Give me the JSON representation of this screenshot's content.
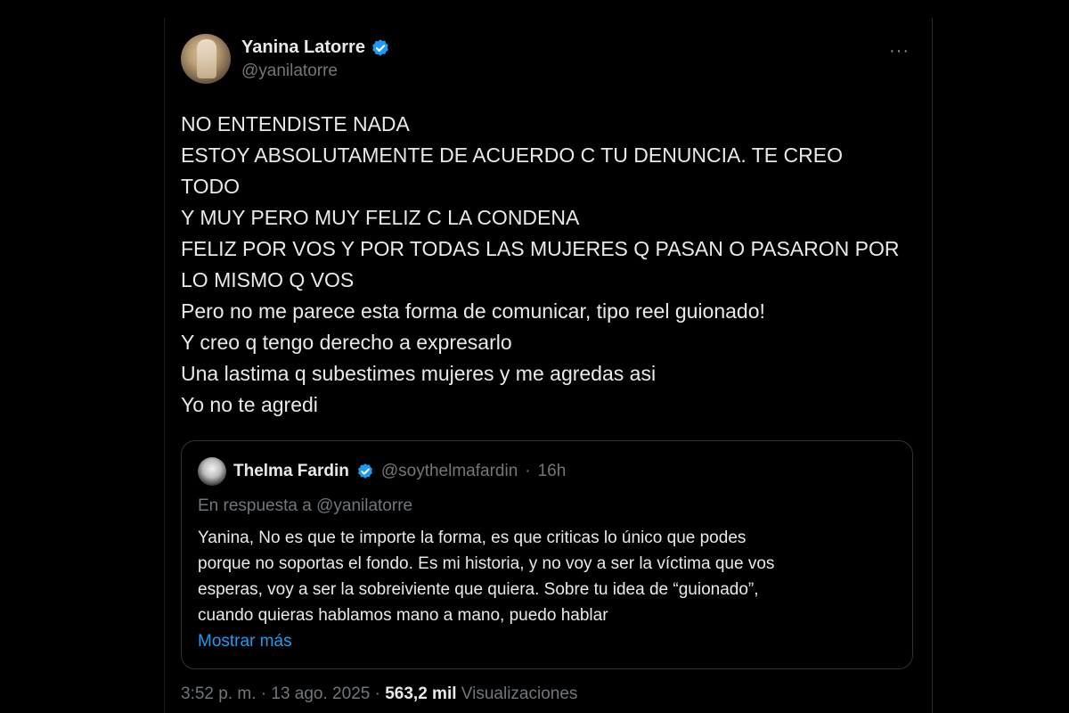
{
  "tweet": {
    "author": {
      "display_name": "Yanina Latorre",
      "handle": "@yanilatorre",
      "verified_icon": "verified-badge-icon",
      "verified_color": "#1d9bf0"
    },
    "more_icon": "···",
    "text_lines": [
      "NO ENTENDISTE NADA",
      "ESTOY ABSOLUTAMENTE DE ACUERDO C TU DENUNCIA. TE CREO",
      "TODO",
      "Y MUY PERO MUY FELIZ C LA CONDENA",
      "FELIZ POR VOS Y POR TODAS LAS MUJERES Q PASAN O PASARON POR",
      "LO MISMO Q VOS",
      "Pero no me parece esta forma de comunicar, tipo reel guionado!",
      "Y creo q tengo derecho a expresarlo",
      "Una lastima q subestimes mujeres y me agredas asi",
      "Yo no te agredi"
    ],
    "quote": {
      "display_name": "Thelma Fardin",
      "handle": "@soythelmafardin",
      "dot": "·",
      "time": "16h",
      "reply_prefix": "En respuesta a",
      "reply_mention": "@yanilatorre",
      "text_lines": [
        "Yanina, No es que te importe la forma, es que criticas lo único que podes",
        "porque no soportas el fondo. Es mi historia, y no voy a ser la víctima que vos",
        "esperas, voy a ser la sobreiviente que quiera. Sobre tu idea de “guionado”,",
        "cuando quieras hablamos mano a mano, puedo hablar"
      ],
      "show_more": "Mostrar más"
    },
    "meta": {
      "time": "3:52 p. m.",
      "sep1": "·",
      "date": "13 ago. 2025",
      "sep2": "·",
      "views_count": "563,2 mil",
      "views_label": "Visualizaciones"
    }
  },
  "colors": {
    "background": "#000000",
    "text": "#e7e9ea",
    "secondary": "#71767b",
    "link": "#1d9bf0",
    "border": "#2f3336"
  }
}
